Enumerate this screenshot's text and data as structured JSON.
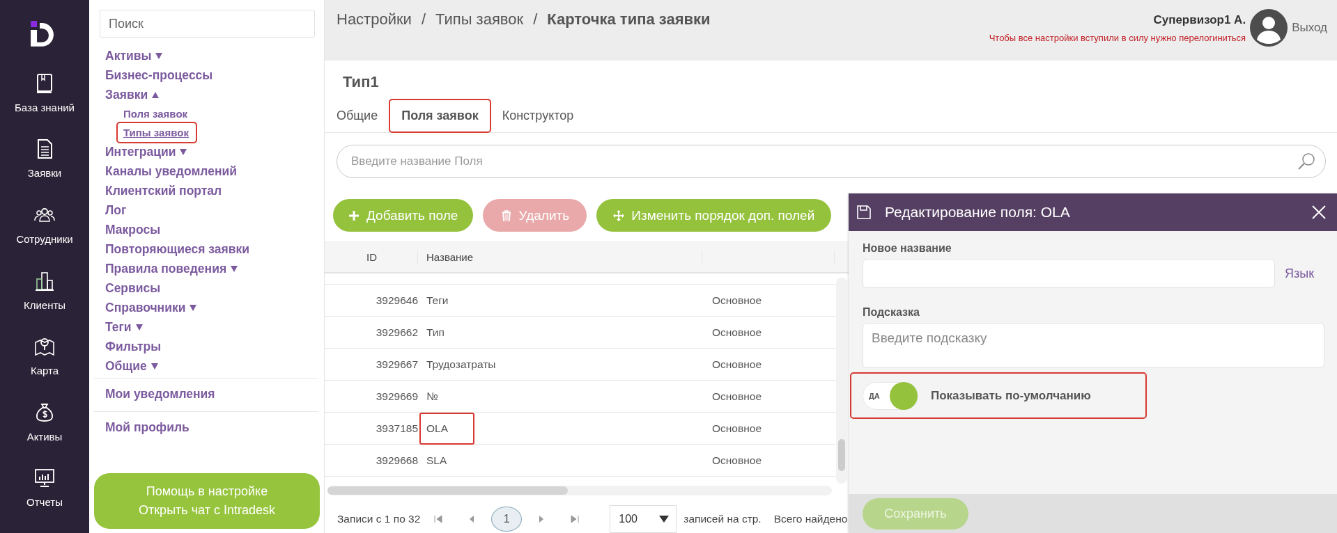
{
  "nav_rail": {
    "items": [
      {
        "label": "База знаний",
        "selected": false
      },
      {
        "label": "Заявки",
        "selected": false
      },
      {
        "label": "Сотрудники",
        "selected": false
      },
      {
        "label": "Клиенты",
        "selected": false
      },
      {
        "label": "Карта",
        "selected": false
      },
      {
        "label": "Активы",
        "selected": false
      },
      {
        "label": "Отчеты",
        "selected": false
      }
    ]
  },
  "settings_menu": {
    "search": {
      "placeholder": "Поиск"
    },
    "items": [
      {
        "label": "Активы",
        "expandable": true,
        "expanded": false
      },
      {
        "label": "Бизнес-процессы",
        "expandable": false,
        "expanded": false
      },
      {
        "label": "Заявки",
        "expandable": true,
        "expanded": true,
        "children": [
          {
            "label": "Поля заявок",
            "selected": false,
            "highlighted": false
          },
          {
            "label": "Типы заявок",
            "selected": true,
            "highlighted": true
          }
        ]
      },
      {
        "label": "Интеграции",
        "expandable": true,
        "expanded": false
      },
      {
        "label": "Каналы уведомлений",
        "expandable": false,
        "expanded": false
      },
      {
        "label": "Клиентский портал",
        "expandable": false,
        "expanded": false
      },
      {
        "label": "Лог",
        "expandable": false,
        "expanded": false
      },
      {
        "label": "Макросы",
        "expandable": false,
        "expanded": false
      },
      {
        "label": "Повторяющиеся заявки",
        "expandable": false,
        "expanded": false
      },
      {
        "label": "Правила поведения",
        "expandable": true,
        "expanded": false
      },
      {
        "label": "Сервисы",
        "expandable": false,
        "expanded": false
      },
      {
        "label": "Справочники",
        "expandable": true,
        "expanded": false
      },
      {
        "label": "Теги",
        "expandable": true,
        "expanded": false
      },
      {
        "label": "Фильтры",
        "expandable": false,
        "expanded": false
      },
      {
        "label": "Общие",
        "expandable": true,
        "expanded": false
      }
    ],
    "secondary": [
      "Мои уведомления",
      "Мой профиль"
    ],
    "help_button": "Помощь в настройке\nОткрыть чат с Intradesk"
  },
  "header": {
    "breadcrumbs": [
      {
        "label": "Настройки",
        "current": false
      },
      {
        "label": "Типы заявок",
        "current": false
      },
      {
        "label": "Карточка типа заявки",
        "current": true
      }
    ],
    "separator": "/",
    "user": {
      "name": "Супервизор1 А.",
      "notice": "Чтобы все настройки вступили в силу нужно перелогиниться",
      "logout": "Выход"
    }
  },
  "card": {
    "title": "Тип1",
    "tabs": [
      {
        "label": "Общие",
        "selected": false,
        "highlighted": false
      },
      {
        "label": "Поля заявок",
        "selected": true,
        "highlighted": true
      },
      {
        "label": "Конструктор",
        "selected": false,
        "highlighted": false
      }
    ],
    "search": {
      "placeholder": "Введите название Поля"
    },
    "toolbar": [
      {
        "kind": "add",
        "label": "Добавить поле",
        "disabled": false
      },
      {
        "kind": "delete",
        "label": "Удалить",
        "disabled": true
      },
      {
        "kind": "reorder",
        "label": "Изменить порядок доп. полей",
        "disabled": false
      }
    ],
    "table": {
      "columns": [
        "ID",
        "Название"
      ],
      "rows": [
        {
          "id": "3929646",
          "name": "Теги",
          "column_3": "Основное",
          "highlighted": false
        },
        {
          "id": "3929662",
          "name": "Тип",
          "column_3": "Основное",
          "highlighted": false
        },
        {
          "id": "3929667",
          "name": "Трудозатраты",
          "column_3": "Основное",
          "highlighted": false
        },
        {
          "id": "3929669",
          "name": "№",
          "column_3": "Основное",
          "highlighted": false
        },
        {
          "id": "3937185",
          "name": "OLA",
          "column_3": "Основное",
          "highlighted": true
        },
        {
          "id": "3929668",
          "name": "SLA",
          "column_3": "Основное",
          "highlighted": false
        }
      ]
    },
    "pagination": {
      "summary": "Записи с 1 по 32",
      "page": "1",
      "per_page": "100",
      "per_page_label": "записей на стр.",
      "total": "Всего найдено"
    }
  },
  "edit_panel": {
    "title": "Редактирование поля: OLA",
    "new_name": {
      "label": "Новое название"
    },
    "language_link": "Язык",
    "hint": {
      "label": "Подсказка",
      "placeholder": "Введите подсказку"
    },
    "toggle": {
      "on": true,
      "on_label": "ДА",
      "label": "Показывать по-умолчанию",
      "highlighted": true
    },
    "save_button": {
      "label": "Сохранить",
      "disabled": true
    }
  }
}
